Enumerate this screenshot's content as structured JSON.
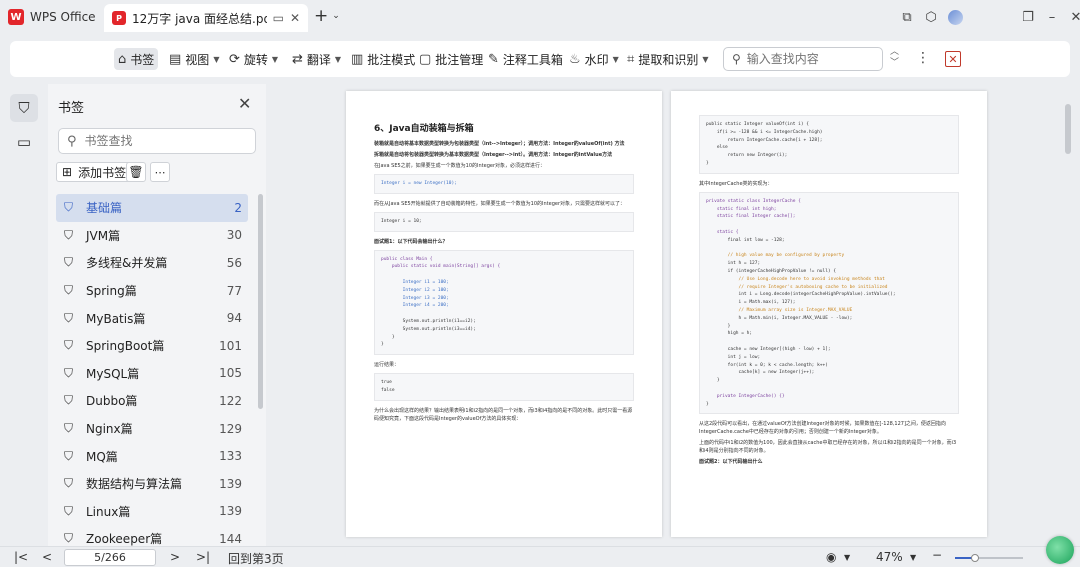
{
  "titlebar": {
    "app_name": "WPS Office",
    "app_logo_text": "W",
    "doc_tab_title": "12万字 java 面经总结.pdf",
    "doc_icon_text": "P"
  },
  "toolbar": {
    "items": [
      {
        "label": "书签",
        "icon": "bookmark-icon",
        "active": true
      },
      {
        "label": "视图",
        "icon": "view-icon",
        "dropdown": true
      },
      {
        "label": "旋转",
        "icon": "rotate-icon",
        "dropdown": true
      },
      {
        "label": "翻译",
        "icon": "translate-icon",
        "dropdown": true
      },
      {
        "label": "批注模式",
        "icon": "annotation-mode-icon"
      },
      {
        "label": "批注管理",
        "icon": "comment-icon"
      },
      {
        "label": "注释工具箱",
        "icon": "annotation-toolbox-icon"
      },
      {
        "label": "水印",
        "icon": "watermark-icon",
        "dropdown": true
      },
      {
        "label": "提取和识别",
        "icon": "extract-icon",
        "dropdown": true
      }
    ],
    "search_placeholder": "输入查找内容"
  },
  "panel": {
    "title": "书签",
    "search_placeholder": "书签查找",
    "add_label": "添加书签",
    "bookmarks": [
      {
        "label": "基础篇",
        "page": "2",
        "selected": true
      },
      {
        "label": "JVM篇",
        "page": "30"
      },
      {
        "label": "多线程&并发篇",
        "page": "56"
      },
      {
        "label": "Spring篇",
        "page": "77"
      },
      {
        "label": "MyBatis篇",
        "page": "94"
      },
      {
        "label": "SpringBoot篇",
        "page": "101"
      },
      {
        "label": "MySQL篇",
        "page": "105"
      },
      {
        "label": "Dubbo篇",
        "page": "122"
      },
      {
        "label": "Nginx篇",
        "page": "129"
      },
      {
        "label": "MQ篇",
        "page": "133"
      },
      {
        "label": "数据结构与算法篇",
        "page": "139"
      },
      {
        "label": "Linux篇",
        "page": "139"
      },
      {
        "label": "Zookeeper篇",
        "page": "144"
      }
    ]
  },
  "page1": {
    "heading": "6、Java自动装箱与拆箱",
    "p1": "装箱就是自动将基本数据类型转换为包装器类型（int-->Integer）；调用方法：Integer的valueOf(int) 方法",
    "p2": "拆箱就是自动将包装器类型转换为基本数据类型（Integer-->int）。调用方法：Integer的intValue方法",
    "p3": "在Java SE5之前，如果要生成一个数值为10的Integer对象，必须这样进行：",
    "code1": "Integer i = new Integer(10);",
    "p4": "而在从Java SE5开始就提供了自动装箱的特性，如果要生成一个数值为10的Integer对象，只需要这样就可以了：",
    "code2": "Integer i = 10;",
    "p5": "面试题1：以下代码会输出什么？",
    "code3_l1": "public class Main {",
    "code3_l2": "    public static void main(String[] args) {",
    "code3_l3": "        Integer i1 = 100;",
    "code3_l4": "        Integer i2 = 100;",
    "code3_l5": "        Integer i3 = 200;",
    "code3_l6": "        Integer i4 = 200;",
    "code3_l7": "        System.out.println(i1==i2);",
    "code3_l8": "        System.out.println(i3==i4);",
    "code3_l9": "    }",
    "code3_l10": "}",
    "p6": "运行结果：",
    "code4_l1": "true",
    "code4_l2": "false",
    "p7": "为什么会出现这样的结果？输出结果表明i1和i2指向的是同一个对象，而i3和i4指向的是不同的对象。此时只需一看源码便知究竟，下面这段代码是Integer的valueOf方法的具体实现："
  },
  "page2": {
    "codeA_l1": "public static Integer valueOf(int i) {",
    "codeA_l2": "    if(i >= -128 && i <= IntegerCache.high)",
    "codeA_l3": "        return IntegerCache.cache[i + 128];",
    "codeA_l4": "    else",
    "codeA_l5": "        return new Integer(i);",
    "codeA_l6": "}",
    "p1": "其中IntegerCache类的实现为：",
    "codeB_l1": "private static class IntegerCache {",
    "codeB_l2": "    static final int high;",
    "codeB_l3": "    static final Integer cache[];",
    "codeB_l4": "    static {",
    "codeB_l5": "        final int low = -128;",
    "codeB_l6": "        // high value may be configured by property",
    "codeB_l7": "        int h = 127;",
    "codeB_l8": "        if (integerCacheHighPropValue != null) {",
    "codeB_l9": "            // Use Long.decode here to avoid invoking methods that",
    "codeB_l10": "            // require Integer's autoboxing cache to be initialized",
    "codeB_l11": "            int i = Long.decode(integerCacheHighPropValue).intValue();",
    "codeB_l12": "            i = Math.max(i, 127);",
    "codeB_l13": "            // Maximum array size is Integer.MAX_VALUE",
    "codeB_l14": "            h = Math.min(i, Integer.MAX_VALUE - -low);",
    "codeB_l15": "        }",
    "codeB_l16": "        high = h;",
    "codeB_l17": "        cache = new Integer[(high - low) + 1];",
    "codeB_l18": "        int j = low;",
    "codeB_l19": "        for(int k = 0; k < cache.length; k++)",
    "codeB_l20": "            cache[k] = new Integer(j++);",
    "codeB_l21": "    }",
    "codeB_l22": "    private IntegerCache() {}",
    "codeB_l23": "}",
    "p2": "从这2段代码可以看出，在通过valueOf方法创建Integer对象的时候，如果数值在[-128,127]之间，便返回指向IntegerCache.cache中已经存在的对象的引用；否则创建一个新的Integer对象。",
    "p3": "上面的代码中i1和i2的数值为100，因此会直接从cache中取已经存在的对象，所以i1和i2指向的是同一个对象，而i3和i4则是分别指向不同的对象。",
    "p4": "面试题2：以下代码输出什么"
  },
  "status": {
    "page_value": "5/266",
    "back_label": "回到第3页",
    "zoom": "47%",
    "zoom_fraction": 0.3
  }
}
